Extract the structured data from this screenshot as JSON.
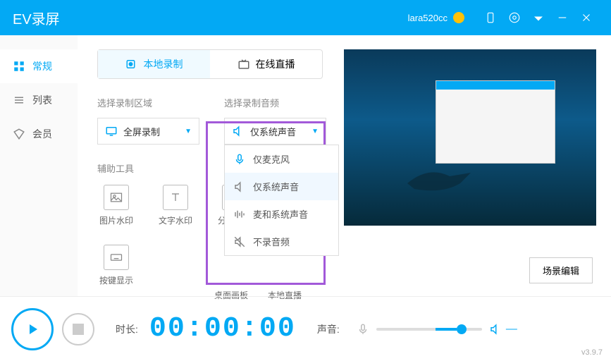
{
  "titlebar": {
    "app_name": "EV录屏",
    "username": "lara520cc"
  },
  "sidebar": {
    "items": [
      {
        "label": "常规"
      },
      {
        "label": "列表"
      },
      {
        "label": "会员"
      }
    ]
  },
  "tabs": {
    "local": "本地录制",
    "live": "在线直播"
  },
  "area": {
    "label": "选择录制区域",
    "value": "全屏录制"
  },
  "audio": {
    "label": "选择录制音频",
    "value": "仅系统声音",
    "options": [
      {
        "label": "仅麦克风"
      },
      {
        "label": "仅系统声音"
      },
      {
        "label": "麦和系统声音"
      },
      {
        "label": "不录音频"
      }
    ]
  },
  "tools": {
    "label": "辅助工具",
    "items": [
      {
        "label": "图片水印"
      },
      {
        "label": "文字水印"
      },
      {
        "label": "分屏录制"
      },
      {
        "label": "按键显示"
      }
    ],
    "extra": [
      {
        "label": "桌面画板"
      },
      {
        "label": "本地直播"
      }
    ]
  },
  "preview": {
    "edit_btn": "场景编辑"
  },
  "footer": {
    "duration_label": "时长:",
    "timer": "00:00:00",
    "sound_label": "声音:",
    "version": "v3.9.7"
  }
}
